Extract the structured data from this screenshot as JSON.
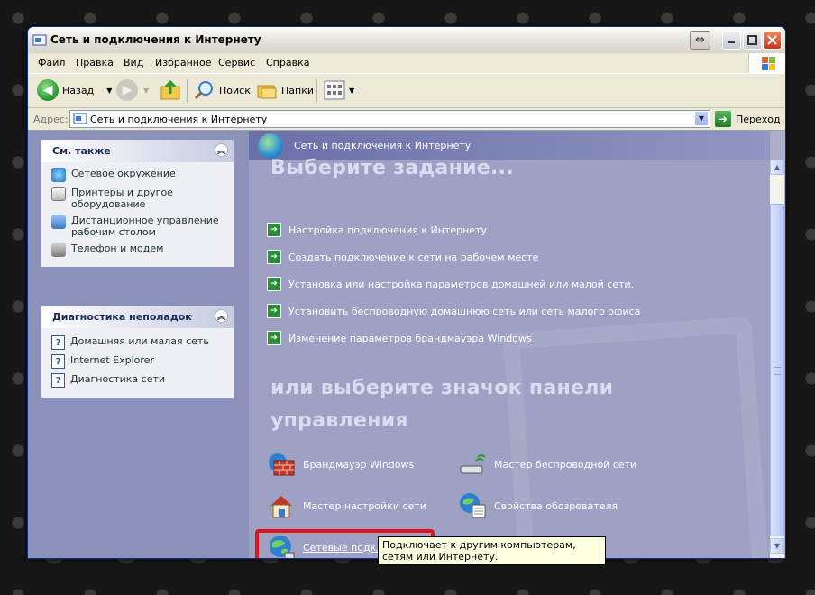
{
  "window": {
    "title": "Сеть и подключения к Интернету"
  },
  "menu": {
    "items": [
      "Файл",
      "Правка",
      "Вид",
      "Избранное",
      "Сервис",
      "Справка"
    ]
  },
  "toolbar": {
    "back_label": "Назад",
    "search_label": "Поиск",
    "folders_label": "Папки"
  },
  "address": {
    "label": "Адрес:",
    "value": "Сеть и подключения к Интернету",
    "go_label": "Переход"
  },
  "left": {
    "see_also": {
      "title": "См. также",
      "items": [
        "Сетевое окружение",
        "Принтеры и другое оборудование",
        "Дистанционное управление рабочим столом",
        "Телефон и модем"
      ]
    },
    "troubleshoot": {
      "title": "Диагностика неполадок",
      "items": [
        "Домашняя или малая сеть",
        "Internet Explorer",
        "Диагностика сети"
      ]
    }
  },
  "main": {
    "header": "Сеть и подключения к Интернету",
    "pick_task": "Выберите задание...",
    "tasks": [
      "Настройка подключения к Интернету",
      "Создать подключение к сети на рабочем месте",
      "Установка или настройка параметров домашней или малой сети.",
      "Установить беспроводную домашнюю сеть или сеть малого офиса",
      "Изменение параметров брандмауэра Windows"
    ],
    "pick_icon_line1": "или выберите значок панели",
    "pick_icon_line2": "управления",
    "icons": [
      "Брандмауэр Windows",
      "Мастер беспроводной сети",
      "Мастер настройки сети",
      "Свойства обозревателя",
      "Сетевые подключения"
    ]
  },
  "tooltip": {
    "text": "Подключает к другим компьютерам, сетям или Интернету."
  },
  "colors": {
    "title_bar": "#e5e3da",
    "left_pane": "#8c91b9",
    "main_pane": "#9ea1c3",
    "highlight_box": "#e0141b",
    "tooltip_bg": "#ffffe1"
  }
}
